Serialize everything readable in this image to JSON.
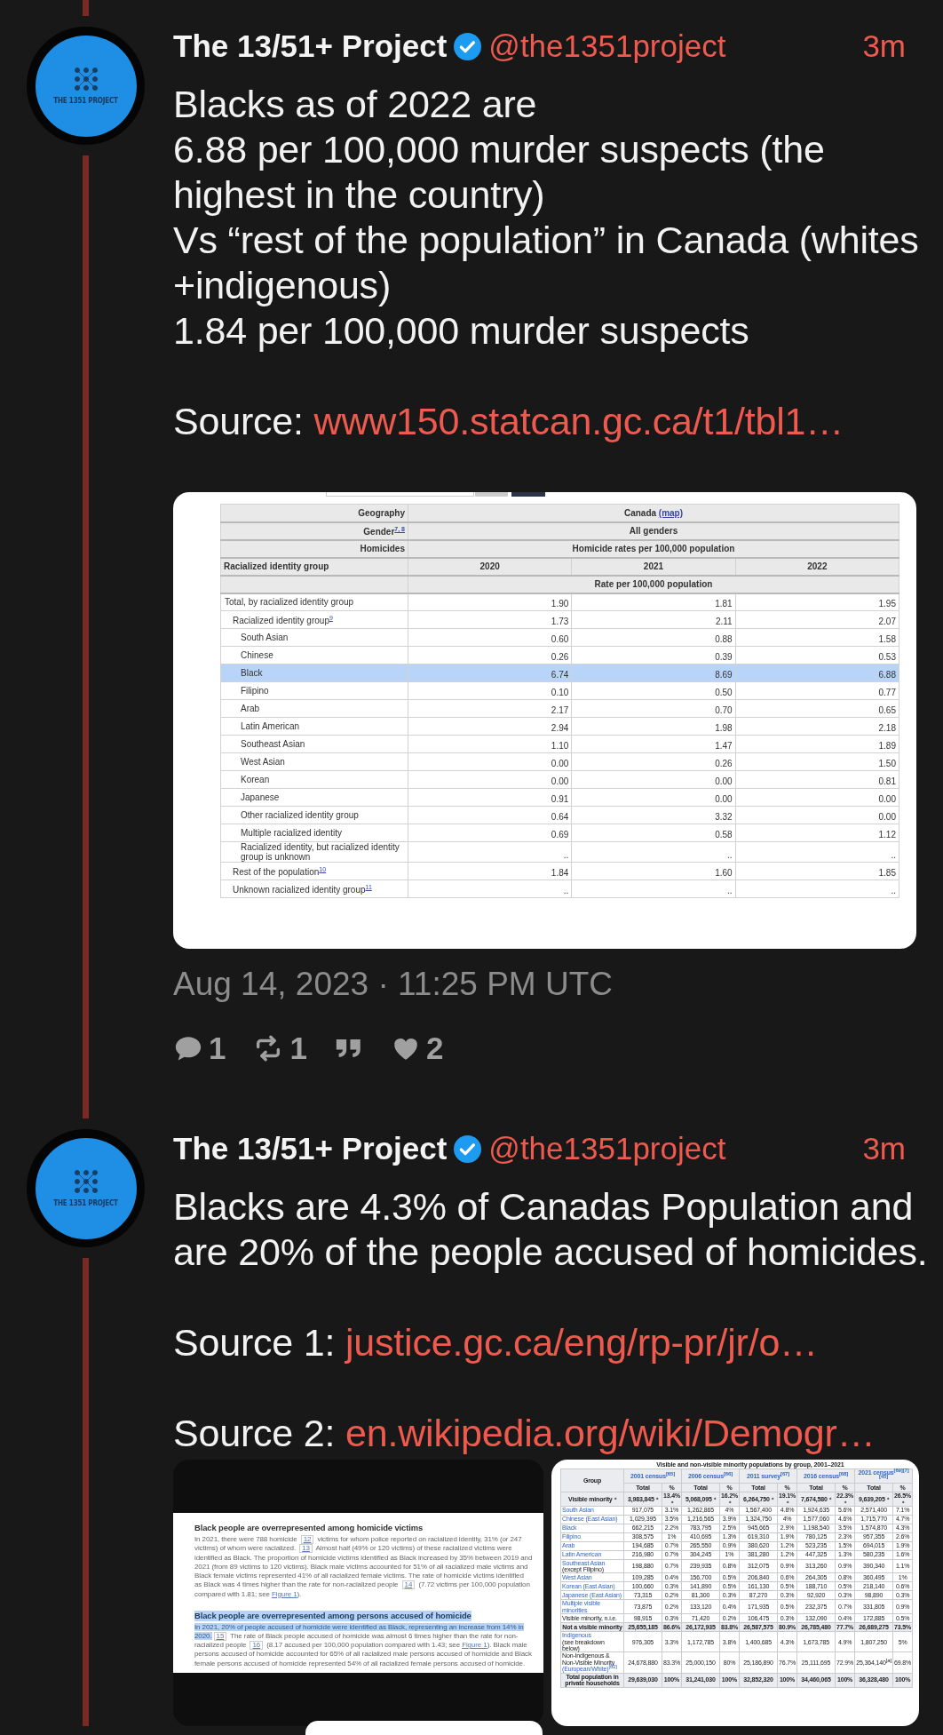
{
  "tweets": [
    {
      "author": {
        "name": "The 13/51+ Project",
        "verified": true,
        "handle": "@the1351project",
        "avatar_label": "THE 1351 PROJECT"
      },
      "time": "3m",
      "paragraphs": [
        [
          {
            "kind": "text",
            "text": "Blacks as of 2022 are\n6.88 per 100,000 murder suspects (the highest in the country)\nVs “rest of the population” in Canada (whites +indigenous)\n1.84 per 100,000 murder suspects"
          }
        ],
        [
          {
            "kind": "text",
            "text": "Source: "
          },
          {
            "kind": "link",
            "text": "www150.statcan.gc.ca/t1/tbl1…"
          }
        ]
      ],
      "media": [
        {
          "kind": "stat_table",
          "header_rows": [
            {
              "label": "Geography",
              "value": "Canada",
              "link": "(map)"
            },
            {
              "label": "Gender$^{7, 8}$",
              "value": "All genders"
            },
            {
              "label": "Homicides",
              "value": "Homicide rates per 100,000 population"
            }
          ],
          "group_heading": "Racialized identity group",
          "years": [
            "2020",
            "2021",
            "2022"
          ],
          "unit": "Rate per 100,000 population",
          "rows": [
            {
              "label": "Total, by racialized identity group",
              "values": [
                "1.90",
                "1.81",
                "1.95"
              ],
              "highlighted": false,
              "children": [
                {
                  "label": "Racialized identity group$^{9}$",
                  "values": [
                    "1.73",
                    "2.11",
                    "2.07"
                  ],
                  "highlighted": false,
                  "children": [
                    {
                      "label": "South Asian",
                      "values": [
                        "0.60",
                        "0.88",
                        "1.58"
                      ],
                      "highlighted": false
                    },
                    {
                      "label": "Chinese",
                      "values": [
                        "0.26",
                        "0.39",
                        "0.53"
                      ],
                      "highlighted": false
                    },
                    {
                      "label": "Black",
                      "values": [
                        "6.74",
                        "8.69",
                        "6.88"
                      ],
                      "highlighted": true
                    },
                    {
                      "label": "Filipino",
                      "values": [
                        "0.10",
                        "0.50",
                        "0.77"
                      ],
                      "highlighted": false
                    },
                    {
                      "label": "Arab",
                      "values": [
                        "2.17",
                        "0.70",
                        "0.65"
                      ],
                      "highlighted": false
                    },
                    {
                      "label": "Latin American",
                      "values": [
                        "2.94",
                        "1.98",
                        "2.18"
                      ],
                      "highlighted": false
                    },
                    {
                      "label": "Southeast Asian",
                      "values": [
                        "1.10",
                        "1.47",
                        "1.89"
                      ],
                      "highlighted": false
                    },
                    {
                      "label": "West Asian",
                      "values": [
                        "0.00",
                        "0.26",
                        "1.50"
                      ],
                      "highlighted": false
                    },
                    {
                      "label": "Korean",
                      "values": [
                        "0.00",
                        "0.00",
                        "0.81"
                      ],
                      "highlighted": false
                    },
                    {
                      "label": "Japanese",
                      "values": [
                        "0.91",
                        "0.00",
                        "0.00"
                      ],
                      "highlighted": false
                    },
                    {
                      "label": "Other racialized identity group",
                      "values": [
                        "0.64",
                        "3.32",
                        "0.00"
                      ],
                      "highlighted": false
                    },
                    {
                      "label": "Multiple racialized identity",
                      "values": [
                        "0.69",
                        "0.58",
                        "1.12"
                      ],
                      "highlighted": false
                    },
                    {
                      "label": "Racialized identity, but racialized identity group is unknown",
                      "values": [
                        "..",
                        "..",
                        ".."
                      ],
                      "highlighted": false
                    }
                  ]
                },
                {
                  "label": "Rest of the population$^{10}$",
                  "values": [
                    "1.84",
                    "1.60",
                    "1.85"
                  ],
                  "highlighted": false
                },
                {
                  "label": "Unknown racialized identity group$^{11}$",
                  "values": [
                    "..",
                    "..",
                    ".."
                  ],
                  "highlighted": false
                }
              ]
            }
          ]
        }
      ],
      "date": "Aug 14, 2023 · 11:25 PM UTC",
      "stats": [
        {
          "kind": "replies",
          "count": "1"
        },
        {
          "kind": "retweets",
          "count": "1"
        },
        {
          "kind": "quotes"
        },
        {
          "kind": "likes",
          "count": "2"
        }
      ]
    },
    {
      "author": {
        "name": "The 13/51+ Project",
        "verified": true,
        "handle": "@the1351project",
        "avatar_label": "THE 1351 PROJECT"
      },
      "time": "3m",
      "paragraphs": [
        [
          {
            "kind": "text",
            "text": "Blacks are 4.3% of Canadas Population and are 20% of the people accused of homicides."
          }
        ],
        [
          {
            "kind": "text",
            "text": "Source 1: "
          },
          {
            "kind": "link",
            "text": "justice.gc.ca/eng/rp-pr/jr/o…"
          }
        ],
        [
          {
            "kind": "text",
            "text": "Source 2: "
          },
          {
            "kind": "link",
            "text": "en.wikipedia.org/wiki/Demogr…"
          }
        ]
      ],
      "media": [
        {
          "kind": "document",
          "sections": [
            {
              "heading": "Black people are overrepresented among homicide victims",
              "highlighted": false,
              "paragraph": [
                {
                  "kind": "text",
                  "text": "In 2021, there were 788 homicide ",
                  "highlighted": false
                },
                {
                  "kind": "ref",
                  "text": "12"
                },
                {
                  "kind": "text",
                  "text": " victims for whom police reported on racialized identity, 31% (or 247 victims) of whom were racialized. ",
                  "highlighted": false
                },
                {
                  "kind": "ref",
                  "text": "13"
                },
                {
                  "kind": "text",
                  "text": " Almost half (49% or 120 victims) of these racialized victims were identified as Black. The proportion of homicide victims identified as Black increased by 35% between 2019 and 2021 (from 89 victims to 120 victims). Black male victims accounted for 51% of all racialized male victims and Black female victims represented 41% of all racialized female victims. The rate of homicide victims identified as Black was 4 times higher than the rate for non-racialized people ",
                  "highlighted": false
                },
                {
                  "kind": "ref",
                  "text": "14"
                },
                {
                  "kind": "text",
                  "text": " (7.72 victims per 100,000 population compared with 1.81; see ",
                  "highlighted": false
                },
                {
                  "kind": "link",
                  "text": "Figure 1"
                },
                {
                  "kind": "text",
                  "text": ").",
                  "highlighted": false
                }
              ]
            },
            {
              "heading": "Black people are overrepresented among persons accused of homicide",
              "highlighted": true,
              "paragraph": [
                {
                  "kind": "text",
                  "text": "In 2021, 20% of people accused of homicide were identified as Black, representing an increase from 14% in 2020.",
                  "highlighted": true
                },
                {
                  "kind": "ref",
                  "text": "15"
                },
                {
                  "kind": "text",
                  "text": " The rate of Black people accused of homicide was almost 6 times higher than the rate for non-racialized people ",
                  "highlighted": false
                },
                {
                  "kind": "ref",
                  "text": "16"
                },
                {
                  "kind": "text",
                  "text": " (8.17 accused per 100,000 population compared with 1.43; see ",
                  "highlighted": false
                },
                {
                  "kind": "link",
                  "text": "Figure 1"
                },
                {
                  "kind": "text",
                  "text": "). Black male persons accused of homicide accounted for 65% of all racialized male persons accused of homicide and Black female persons accused of homicide represented 54% of all racialized female persons accused of homicide.",
                  "highlighted": false
                }
              ]
            }
          ]
        },
        {
          "kind": "wiki_table",
          "caption": "Visible and non-visible minority populations by group, 2001–2021",
          "group_heading": "Group",
          "periods": [
            {
              "label": "2001 census$^{[65]}$",
              "columns": [
                "Total",
                "%"
              ]
            },
            {
              "label": "2006 census$^{[66]}$",
              "columns": [
                "Total",
                "%"
              ]
            },
            {
              "label": "2011 survey$^{[67]}$",
              "columns": [
                "Total",
                "%"
              ]
            },
            {
              "label": "2016 census$^{[68]}$",
              "columns": [
                "Total",
                "%"
              ]
            },
            {
              "label": "2021 census$^{[69][7][45]}$",
              "columns": [
                "Total",
                "%"
              ]
            }
          ],
          "rows": [
            {
              "kind": "sortable_total",
              "label": "Visible minority",
              "link": false,
              "cells": [
                "3,983,845",
                "13.4%",
                "5,068,095",
                "16.2%",
                "6,264,750",
                "19.1%",
                "7,674,580",
                "22.3%",
                "9,639,205",
                "26.5%"
              ]
            },
            {
              "kind": "group",
              "label": "South Asian",
              "link": true,
              "cells": [
                "917,075",
                "3.1%",
                "1,262,865",
                "4%",
                "1,567,400",
                "4.8%",
                "1,924,635",
                "5.6%",
                "2,571,400",
                "7.1%"
              ]
            },
            {
              "kind": "group",
              "label": "Chinese (East Asian)",
              "link": true,
              "cells": [
                "1,029,395",
                "3.5%",
                "1,216,565",
                "3.9%",
                "1,324,750",
                "4%",
                "1,577,060",
                "4.6%",
                "1,715,770",
                "4.7%"
              ]
            },
            {
              "kind": "group",
              "label": "Black",
              "link": true,
              "cells": [
                "662,215",
                "2.2%",
                "783,795",
                "2.5%",
                "945,665",
                "2.9%",
                "1,198,540",
                "3.5%",
                "1,574,870",
                "4.3%"
              ]
            },
            {
              "kind": "group",
              "label": "Filipino",
              "link": true,
              "cells": [
                "308,575",
                "1%",
                "410,695",
                "1.3%",
                "619,310",
                "1.9%",
                "780,125",
                "2.3%",
                "957,355",
                "2.6%"
              ]
            },
            {
              "kind": "group",
              "label": "Arab",
              "link": true,
              "cells": [
                "194,685",
                "0.7%",
                "265,550",
                "0.9%",
                "380,620",
                "1.2%",
                "523,235",
                "1.5%",
                "694,015",
                "1.9%"
              ]
            },
            {
              "kind": "group",
              "label": "Latin American",
              "link": true,
              "cells": [
                "216,980",
                "0.7%",
                "304,245",
                "1%",
                "381,280",
                "1.2%",
                "447,325",
                "1.3%",
                "580,235",
                "1.6%"
              ]
            },
            {
              "kind": "group",
              "label": "Southeast Asian",
              "link": true,
              "note": "(except Filipino)",
              "note_link": false,
              "cells": [
                "198,880",
                "0.7%",
                "239,935",
                "0.8%",
                "312,075",
                "0.9%",
                "313,260",
                "0.9%",
                "390,340",
                "1.1%"
              ]
            },
            {
              "kind": "group",
              "label": "West Asian",
              "link": true,
              "cells": [
                "109,285",
                "0.4%",
                "156,700",
                "0.5%",
                "206,840",
                "0.6%",
                "264,305",
                "0.8%",
                "360,495",
                "1%"
              ]
            },
            {
              "kind": "group",
              "label": "Korean (East Asian)",
              "link": true,
              "cells": [
                "100,660",
                "0.3%",
                "141,890",
                "0.5%",
                "161,130",
                "0.5%",
                "188,710",
                "0.5%",
                "218,140",
                "0.6%"
              ]
            },
            {
              "kind": "group",
              "label": "Japanese (East Asian)",
              "link": true,
              "cells": [
                "73,315",
                "0.2%",
                "81,300",
                "0.3%",
                "87,270",
                "0.3%",
                "92,920",
                "0.3%",
                "98,890",
                "0.3%"
              ]
            },
            {
              "kind": "group",
              "label": "Multiple visible minorities",
              "link": true,
              "cells": [
                "73,875",
                "0.2%",
                "133,120",
                "0.4%",
                "171,935",
                "0.5%",
                "232,375",
                "0.7%",
                "331,805",
                "0.9%"
              ]
            },
            {
              "kind": "group",
              "label": "Visible minority, n.i.e.",
              "link": false,
              "cells": [
                "98,915",
                "0.3%",
                "71,420",
                "0.2%",
                "106,475",
                "0.3%",
                "132,090",
                "0.4%",
                "172,885",
                "0.5%"
              ]
            },
            {
              "kind": "total",
              "label": "Not a visible minority",
              "link": false,
              "cells": [
                "25,655,185",
                "86.6%",
                "26,172,935",
                "83.8%",
                "26,587,575",
                "80.9%",
                "26,785,480",
                "77.7%",
                "26,689,275",
                "73.5%"
              ]
            },
            {
              "kind": "group",
              "label": "Indigenous",
              "link": true,
              "note": "(see breakdown below)",
              "note_link": false,
              "cells": [
                "976,305",
                "3.3%",
                "1,172,785",
                "3.8%",
                "1,400,685",
                "4.3%",
                "1,673,785",
                "4.9%",
                "1,807,250",
                "5%"
              ]
            },
            {
              "kind": "group",
              "label": "Non-Indigenous & Non-Visible Minority",
              "link": false,
              "note": "(European/White)$^{[62]}$",
              "note_link": true,
              "cells": [
                "24,678,880",
                "83.3%",
                "25,000,150",
                "80%",
                "25,186,890",
                "76.7%",
                "25,111,695",
                "72.9%",
                "25,364,140$^{[a]}$",
                "69.8%"
              ]
            },
            {
              "kind": "total",
              "label": "Total population in private households",
              "link": false,
              "cells": [
                "29,639,030",
                "100%",
                "31,241,030",
                "100%",
                "32,852,320",
                "100%",
                "34,460,065",
                "100%",
                "36,328,480",
                "100%"
              ]
            }
          ]
        }
      ]
    }
  ]
}
